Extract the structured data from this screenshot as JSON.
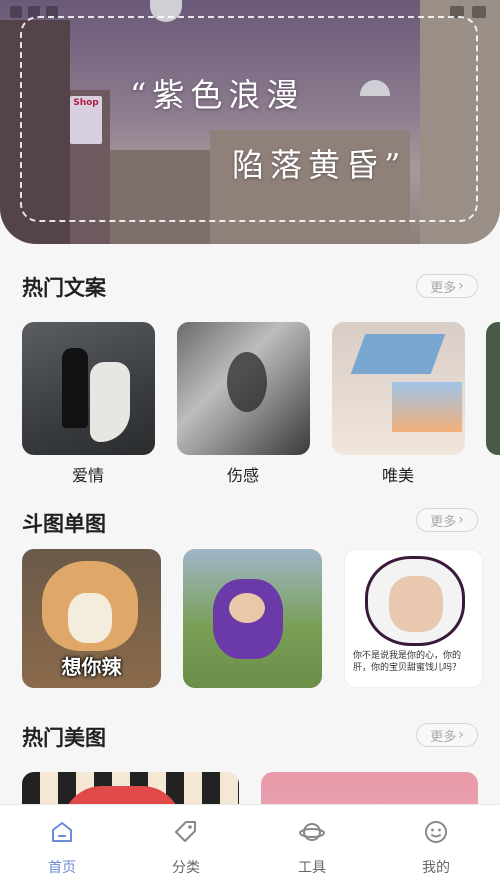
{
  "hero": {
    "line1": "“紫色浪漫",
    "line2": "陷落黄昏”",
    "shop_sign": "Shop"
  },
  "sections": [
    {
      "title": "热门文案",
      "more": "更多",
      "items": [
        {
          "label": "爱情"
        },
        {
          "label": "伤感"
        },
        {
          "label": "唯美"
        }
      ]
    },
    {
      "title": "斗图单图",
      "more": "更多",
      "items": [
        {
          "caption": "想你辣"
        },
        {
          "caption": ""
        },
        {
          "caption": "你不是说我是你的心，你的肝，你的宝贝甜蜜饯儿吗？"
        }
      ]
    },
    {
      "title": "热门美图",
      "more": "更多"
    }
  ],
  "tabbar": {
    "items": [
      {
        "label": "首页",
        "icon": "home-icon",
        "active": true
      },
      {
        "label": "分类",
        "icon": "tag-icon",
        "active": false
      },
      {
        "label": "工具",
        "icon": "planet-icon",
        "active": false
      },
      {
        "label": "我的",
        "icon": "smile-icon",
        "active": false
      }
    ],
    "accent": "#6a8cd8"
  }
}
